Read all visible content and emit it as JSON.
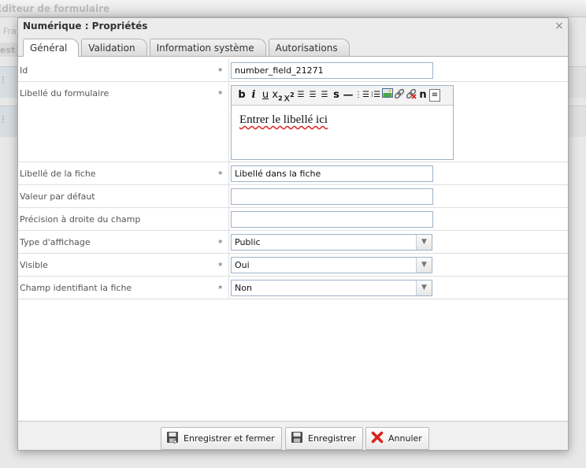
{
  "background": {
    "window_title": "Éditeur de formulaire",
    "tab_fragment": "Fra",
    "strip_fragment": "est"
  },
  "dialog": {
    "title": "Numérique : Propriétés",
    "close_glyph": "×",
    "tabs": [
      {
        "label": "Général",
        "active": true
      },
      {
        "label": "Validation",
        "active": false
      },
      {
        "label": "Information système",
        "active": false
      },
      {
        "label": "Autorisations",
        "active": false
      }
    ],
    "required_marker": "*",
    "fields": {
      "id": {
        "label": "Id",
        "value": "number_field_21271",
        "required": true
      },
      "form_label": {
        "label": "Libellé du formulaire",
        "value": "Entrer le libellé ici",
        "required": true
      },
      "sheet_label": {
        "label": "Libellé de la fiche",
        "value": "Libellé dans la fiche",
        "required": true
      },
      "default_value": {
        "label": "Valeur par défaut",
        "value": "",
        "required": false
      },
      "right_precision": {
        "label": "Précision à droite du champ",
        "value": "",
        "required": false
      },
      "display_type": {
        "label": "Type d'affichage",
        "value": "Public",
        "required": true
      },
      "visible": {
        "label": "Visible",
        "value": "Oui",
        "required": true
      },
      "identifier": {
        "label": "Champ identifiant la fiche",
        "value": "Non",
        "required": true
      }
    },
    "editor_toolbar": [
      "bold",
      "italic",
      "underline",
      "subscript",
      "superscript",
      "align-left",
      "justify",
      "align-right",
      "strikethrough",
      "horizontal-rule",
      "ordered-list",
      "unordered-list",
      "image",
      "link",
      "unlink",
      "hidden-n",
      "source"
    ],
    "buttons": {
      "save_close": "Enregistrer et fermer",
      "save": "Enregistrer",
      "cancel": "Annuler"
    },
    "colors": {
      "cancel_icon": "#d9231d",
      "link_underline": "#d22"
    }
  }
}
